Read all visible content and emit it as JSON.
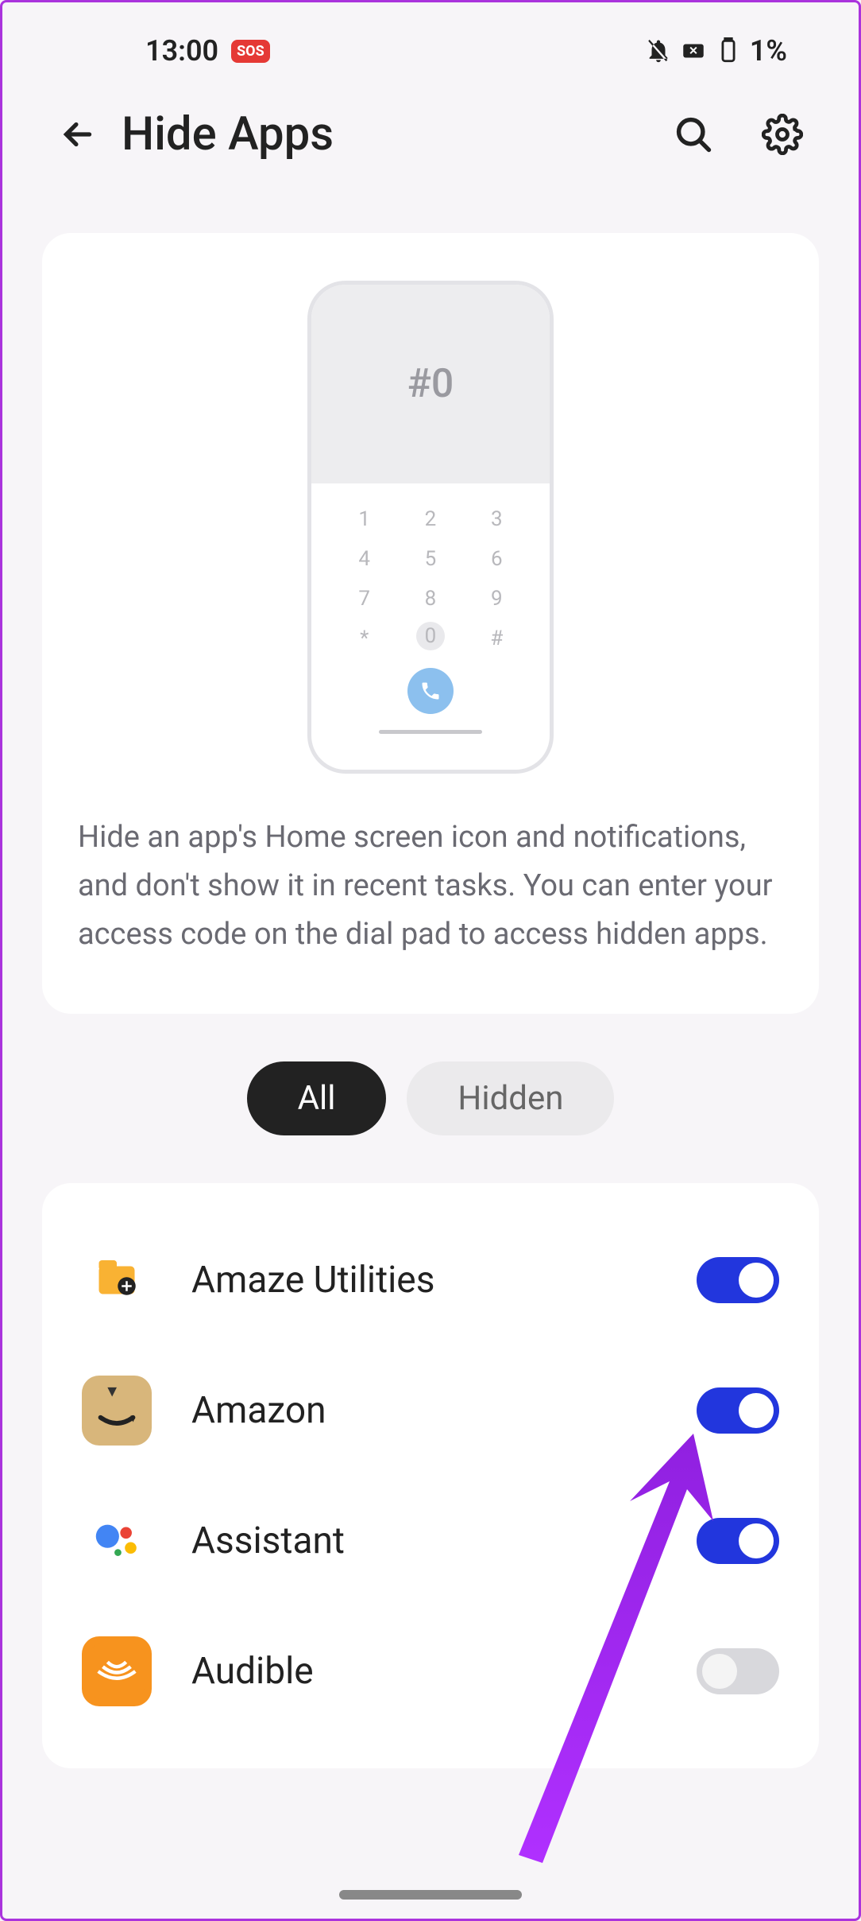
{
  "status": {
    "time": "13:00",
    "sos": "SOS",
    "battery": "1%"
  },
  "header": {
    "title": "Hide Apps"
  },
  "illustration": {
    "display": "#0",
    "keys": [
      "1",
      "2",
      "3",
      "4",
      "5",
      "6",
      "7",
      "8",
      "9",
      "*",
      "0",
      "#"
    ]
  },
  "info_text": "Hide an app's Home screen icon and notifications, and don't show it in recent tasks. You can enter your access code on the dial pad to access hidden apps.",
  "tabs": {
    "all": "All",
    "hidden": "Hidden"
  },
  "apps": [
    {
      "name": "Amaze Utilities",
      "on": true
    },
    {
      "name": "Amazon",
      "on": true
    },
    {
      "name": "Assistant",
      "on": true
    },
    {
      "name": "Audible",
      "on": false
    }
  ]
}
